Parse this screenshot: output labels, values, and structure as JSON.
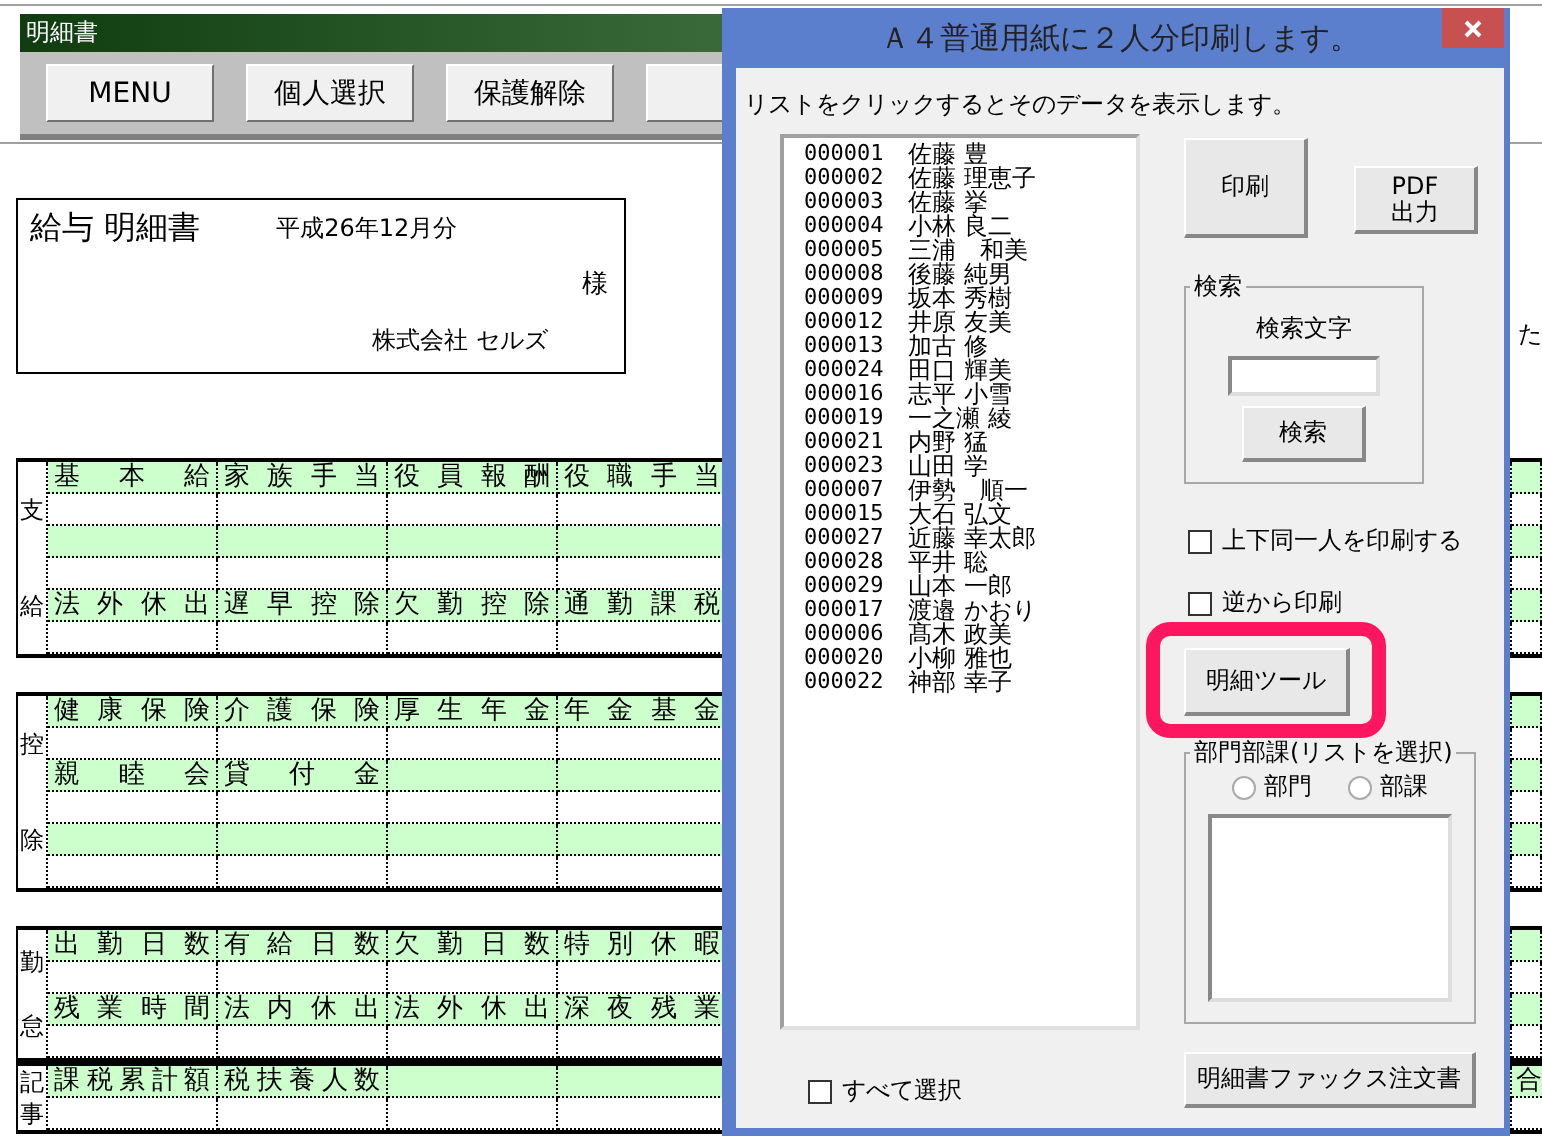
{
  "window": {
    "title": "明細書"
  },
  "toolbar": [
    {
      "kind": "button",
      "label": "MENU"
    },
    {
      "kind": "button",
      "label": "個人選択"
    },
    {
      "kind": "button",
      "label": "保護解除"
    },
    {
      "kind": "covered"
    }
  ],
  "payslip": {
    "title": "給与 明細書",
    "period": "平成26年12月分",
    "honorific": "様",
    "company": "株式会社 セルズ"
  },
  "edge_text": "た",
  "sections": [
    {
      "label": [
        "支",
        "給"
      ],
      "rows": [
        {
          "kind": "header",
          "cells": [
            "基本給",
            "家族手当",
            "役員報酬",
            "役職手当"
          ]
        },
        {
          "kind": "blank"
        },
        {
          "kind": "shaded"
        },
        {
          "kind": "blank"
        },
        {
          "kind": "header",
          "cells": [
            "法外休出",
            "遅早控除",
            "欠勤控除",
            "通勤課税"
          ]
        },
        {
          "kind": "blank"
        }
      ]
    },
    {
      "label": [
        "控",
        "除"
      ],
      "rows": [
        {
          "kind": "header",
          "cells": [
            "健康保険",
            "介護保険",
            "厚生年金",
            "年金基金"
          ]
        },
        {
          "kind": "blank"
        },
        {
          "kind": "header",
          "cells": [
            "親睦会",
            "貸付金"
          ]
        },
        {
          "kind": "blank"
        },
        {
          "kind": "shaded"
        },
        {
          "kind": "blank"
        }
      ]
    },
    {
      "label": [
        "勤",
        "怠"
      ],
      "rows": [
        {
          "kind": "header",
          "cells": [
            "出勤日数",
            "有給日数",
            "欠勤日数",
            "特別休暇"
          ]
        },
        {
          "kind": "blank"
        },
        {
          "kind": "header",
          "cells": [
            "残業時間",
            "法内休出",
            "法外休出",
            "深夜残業"
          ]
        },
        {
          "kind": "blank"
        }
      ]
    },
    {
      "label": [
        "記",
        "事"
      ],
      "rows": [
        {
          "kind": "header",
          "cells": [
            "課税累計額",
            "税扶養人数"
          ],
          "edge": "合"
        },
        {
          "kind": "blank"
        }
      ]
    }
  ],
  "dialog": {
    "title": "Ａ４普通用紙に２人分印刷します。",
    "instruction": "リストをクリックするとそのデータを表示します。",
    "employees": [
      {
        "id": "000001",
        "name": "佐藤 豊"
      },
      {
        "id": "000002",
        "name": "佐藤 理恵子"
      },
      {
        "id": "000003",
        "name": "佐藤 挙"
      },
      {
        "id": "000004",
        "name": "小林 良二"
      },
      {
        "id": "000005",
        "name": "三浦　和美"
      },
      {
        "id": "000008",
        "name": "後藤 純男"
      },
      {
        "id": "000009",
        "name": "坂本 秀樹"
      },
      {
        "id": "000012",
        "name": "井原 友美"
      },
      {
        "id": "000013",
        "name": "加古 修"
      },
      {
        "id": "000024",
        "name": "田口 輝美"
      },
      {
        "id": "000016",
        "name": "志平 小雪"
      },
      {
        "id": "000019",
        "name": "一之瀬 綾"
      },
      {
        "id": "000021",
        "name": "内野 猛"
      },
      {
        "id": "000023",
        "name": "山田 学"
      },
      {
        "id": "000007",
        "name": "伊勢　順一"
      },
      {
        "id": "000015",
        "name": "大石 弘文"
      },
      {
        "id": "000027",
        "name": "近藤 幸太郎"
      },
      {
        "id": "000028",
        "name": "平井 聡"
      },
      {
        "id": "000029",
        "name": "山本 一郎"
      },
      {
        "id": "000017",
        "name": "渡邉 かおり"
      },
      {
        "id": "000006",
        "name": "髙木 政美"
      },
      {
        "id": "000020",
        "name": "小柳 雅也"
      },
      {
        "id": "000022",
        "name": "神部 幸子"
      }
    ],
    "print_button": "印刷",
    "pdf_button": [
      "PDF",
      "出力"
    ],
    "search": {
      "group": "検索",
      "label": "検索文字",
      "button": "検索"
    },
    "options": [
      {
        "label": "上下同一人を印刷する",
        "checked": false
      },
      {
        "label": "逆から印刷",
        "checked": false
      }
    ],
    "tool_button": {
      "label": "明細ツール",
      "highlighted": true
    },
    "department": {
      "group": "部門部課(リストを選択)",
      "radios": [
        {
          "label": "部門",
          "selected": false
        },
        {
          "label": "部課",
          "selected": false
        }
      ]
    },
    "fax_button": "明細書ファックス注文書",
    "select_all": {
      "label": "すべて選択",
      "checked": false
    }
  }
}
